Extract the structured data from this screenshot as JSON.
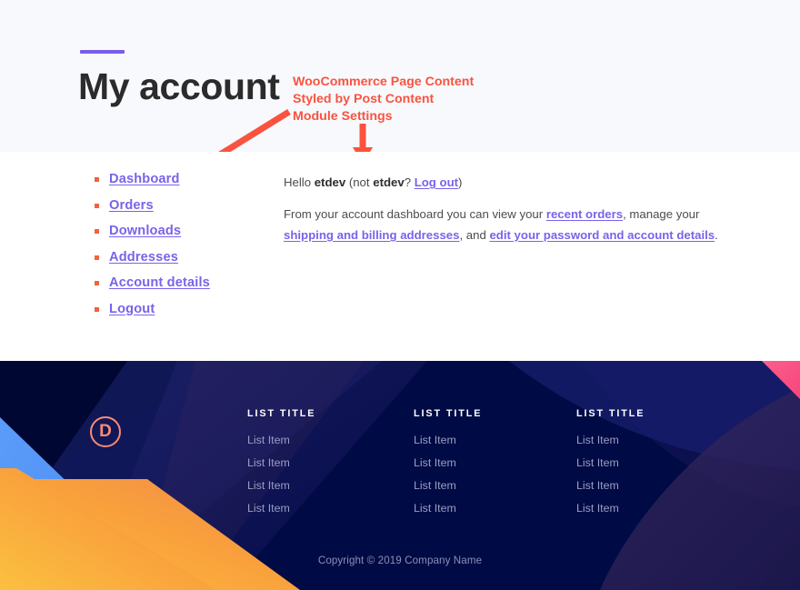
{
  "header": {
    "title": "My account"
  },
  "annotation": {
    "lines": [
      "WooCommerce Page Content",
      "Styled by Post Content",
      "Module Settings"
    ],
    "color": "#f9533f",
    "arrows": [
      "arrow-down-left-icon",
      "arrow-down-icon"
    ]
  },
  "account_nav": {
    "items": [
      {
        "label": "Dashboard"
      },
      {
        "label": "Orders"
      },
      {
        "label": "Downloads"
      },
      {
        "label": "Addresses"
      },
      {
        "label": "Account details"
      },
      {
        "label": "Logout"
      }
    ]
  },
  "account_body": {
    "greeting": {
      "hello": "Hello ",
      "username": "etdev",
      "not_open": " (not ",
      "username2": "etdev",
      "q": "? ",
      "logout_link": "Log out",
      "close": ")"
    },
    "dashboard_text": {
      "part1": "From your account dashboard you can view your ",
      "link1": "recent orders",
      "part2": ", manage your ",
      "link2": "shipping and billing addresses",
      "part3": ", and ",
      "link3": "edit your password and account details",
      "part4": "."
    }
  },
  "footer": {
    "logo_letter": "D",
    "columns": [
      {
        "title": "LIST TITLE",
        "items": [
          "List Item",
          "List Item",
          "List Item",
          "List Item"
        ]
      },
      {
        "title": "LIST TITLE",
        "items": [
          "List Item",
          "List Item",
          "List Item",
          "List Item"
        ]
      },
      {
        "title": "LIST TITLE",
        "items": [
          "List Item",
          "List Item",
          "List Item",
          "List Item"
        ]
      }
    ],
    "copyright": "Copyright © 2019 Company Name"
  },
  "colors": {
    "accent_purple": "#7b5ce8",
    "annotation_red": "#f9533f",
    "bullet_orange": "#f4603f",
    "link_purple": "#7b62ea",
    "footer_navy": "#000a44",
    "footer_blue": "#5b9bf8",
    "footer_orange": "#f9a03c",
    "footer_pink": "#fb5f8d",
    "logo_coral": "#fb8b72",
    "header_bg": "#f8f9fd"
  }
}
